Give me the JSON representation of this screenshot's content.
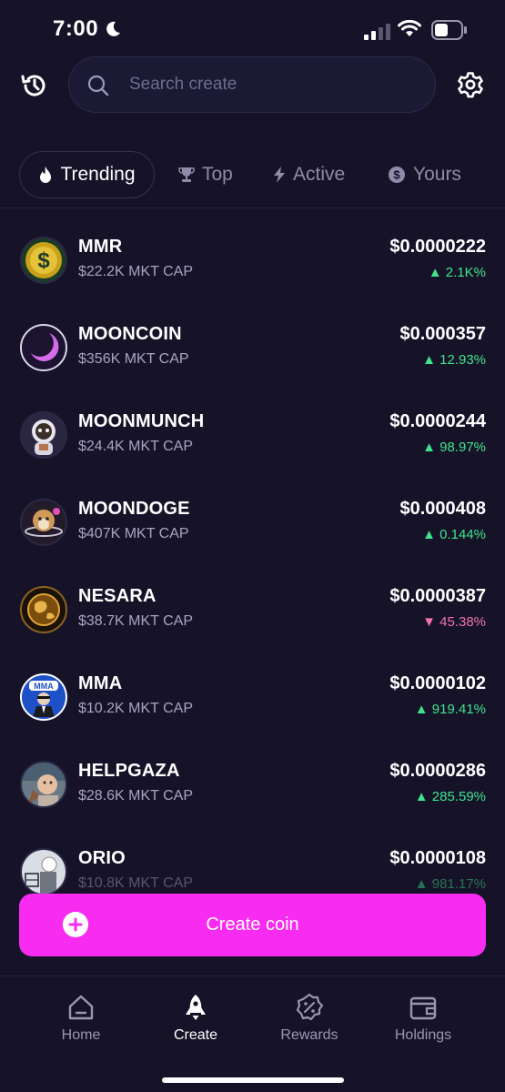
{
  "status": {
    "time": "7:00"
  },
  "search": {
    "placeholder": "Search create"
  },
  "tabs": [
    {
      "label": "Trending",
      "icon": "flame-icon",
      "active": true
    },
    {
      "label": "Top",
      "icon": "trophy-icon",
      "active": false
    },
    {
      "label": "Active",
      "icon": "lightning-icon",
      "active": false
    },
    {
      "label": "Yours",
      "icon": "coin-icon",
      "active": false
    }
  ],
  "coins": [
    {
      "name": "MMR",
      "cap": "$22.2K MKT CAP",
      "price": "$0.0000222",
      "change": "2.1K%",
      "direction": "up"
    },
    {
      "name": "MOONCOIN",
      "cap": "$356K MKT CAP",
      "price": "$0.000357",
      "change": "12.93%",
      "direction": "up"
    },
    {
      "name": "MOONMUNCH",
      "cap": "$24.4K MKT CAP",
      "price": "$0.0000244",
      "change": "98.97%",
      "direction": "up"
    },
    {
      "name": "MOONDOGE",
      "cap": "$407K MKT CAP",
      "price": "$0.000408",
      "change": "0.144%",
      "direction": "up"
    },
    {
      "name": "NESARA",
      "cap": "$38.7K MKT CAP",
      "price": "$0.0000387",
      "change": "45.38%",
      "direction": "down"
    },
    {
      "name": "MMA",
      "cap": "$10.2K MKT CAP",
      "price": "$0.0000102",
      "change": "919.41%",
      "direction": "up"
    },
    {
      "name": "HELPGAZA",
      "cap": "$28.6K MKT CAP",
      "price": "$0.0000286",
      "change": "285.59%",
      "direction": "up"
    },
    {
      "name": "ORIO",
      "cap": "$10.8K MKT CAP",
      "price": "$0.0000108",
      "change": "981.17%",
      "direction": "up"
    }
  ],
  "create_button": {
    "label": "Create coin"
  },
  "nav": [
    {
      "label": "Home",
      "icon": "home-icon"
    },
    {
      "label": "Create",
      "icon": "rocket-icon",
      "active": true
    },
    {
      "label": "Rewards",
      "icon": "percent-badge-icon"
    },
    {
      "label": "Holdings",
      "icon": "wallet-icon"
    }
  ],
  "colors": {
    "background": "#161329",
    "accent": "#f82bf0",
    "up": "#3ee48c",
    "down": "#f272ad"
  }
}
